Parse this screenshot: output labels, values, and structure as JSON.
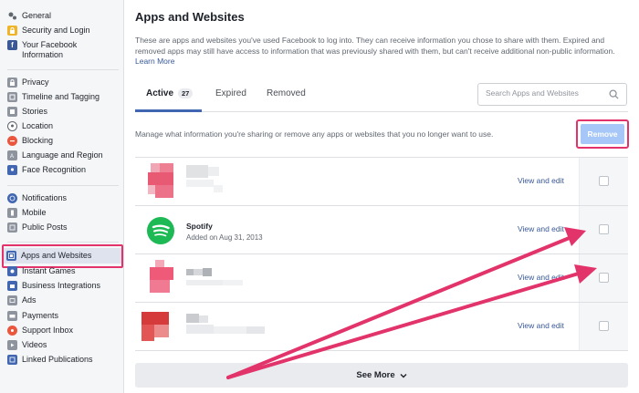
{
  "sidebar": {
    "items": [
      {
        "label": "General",
        "icon": "gear-icon",
        "color": "#606770"
      },
      {
        "label": "Security and Login",
        "icon": "shield-icon",
        "color": "#f0b429"
      },
      {
        "label": "Your Facebook Information",
        "icon": "facebook-icon",
        "color": "#3b5998"
      },
      {
        "label": "Privacy",
        "icon": "lock-icon",
        "color": "#8d949e"
      },
      {
        "label": "Timeline and Tagging",
        "icon": "tag-icon",
        "color": "#8d949e"
      },
      {
        "label": "Stories",
        "icon": "book-icon",
        "color": "#8d949e"
      },
      {
        "label": "Location",
        "icon": "location-icon",
        "color": "#8d949e"
      },
      {
        "label": "Blocking",
        "icon": "block-icon",
        "color": "#e9573f"
      },
      {
        "label": "Language and Region",
        "icon": "language-icon",
        "color": "#8d949e"
      },
      {
        "label": "Face Recognition",
        "icon": "face-icon",
        "color": "#4267b2"
      },
      {
        "label": "Notifications",
        "icon": "globe-icon",
        "color": "#4267b2"
      },
      {
        "label": "Mobile",
        "icon": "mobile-icon",
        "color": "#8d949e"
      },
      {
        "label": "Public Posts",
        "icon": "rss-icon",
        "color": "#8d949e"
      },
      {
        "label": "Apps and Websites",
        "icon": "apps-icon",
        "color": "#4267b2"
      },
      {
        "label": "Instant Games",
        "icon": "games-icon",
        "color": "#4267b2"
      },
      {
        "label": "Business Integrations",
        "icon": "business-icon",
        "color": "#4267b2"
      },
      {
        "label": "Ads",
        "icon": "ads-icon",
        "color": "#8d949e"
      },
      {
        "label": "Payments",
        "icon": "payments-icon",
        "color": "#8d949e"
      },
      {
        "label": "Support Inbox",
        "icon": "support-icon",
        "color": "#e9573f"
      },
      {
        "label": "Videos",
        "icon": "video-icon",
        "color": "#8d949e"
      },
      {
        "label": "Linked Publications",
        "icon": "linked-icon",
        "color": "#4267b2"
      }
    ]
  },
  "main": {
    "title": "Apps and Websites",
    "description": "These are apps and websites you've used Facebook to log into. They can receive information you chose to share with them. Expired and removed apps may still have access to information that was previously shared with them, but can't receive additional non-public information.",
    "learn_more": "Learn More",
    "tabs": [
      {
        "label": "Active",
        "count": "27"
      },
      {
        "label": "Expired"
      },
      {
        "label": "Removed"
      }
    ],
    "search_placeholder": "Search Apps and Websites",
    "manage_text": "Manage what information you're sharing or remove any apps or websites that you no longer want to use.",
    "remove_label": "Remove",
    "apps": [
      {
        "name": "",
        "date": "",
        "view_label": "View and edit"
      },
      {
        "name": "Spotify",
        "date": "Added on Aug 31, 2013",
        "view_label": "View and edit"
      },
      {
        "name": "",
        "date": "",
        "view_label": "View and edit"
      },
      {
        "name": "",
        "date": "",
        "view_label": "View and edit"
      }
    ],
    "see_more": "See More"
  },
  "colors": {
    "accent": "#4267b2",
    "highlight": "#e2336b",
    "spotify": "#1db954",
    "remove_button": "#a6c7f7"
  }
}
